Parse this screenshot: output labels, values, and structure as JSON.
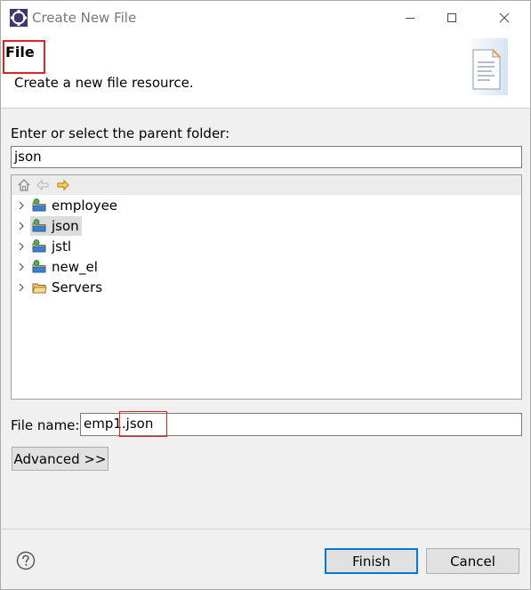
{
  "window": {
    "title": "Create New File"
  },
  "banner": {
    "title": "File",
    "description": "Create a new file resource."
  },
  "parent_folder": {
    "label": "Enter or select the parent folder:",
    "value": "json"
  },
  "tree": {
    "items": [
      {
        "label": "employee",
        "icon": "project-icon",
        "selected": false
      },
      {
        "label": "json",
        "icon": "project-icon",
        "selected": true
      },
      {
        "label": "jstl",
        "icon": "project-icon",
        "selected": false
      },
      {
        "label": "new_el",
        "icon": "project-icon",
        "selected": false
      },
      {
        "label": "Servers",
        "icon": "folder-icon",
        "selected": false
      }
    ]
  },
  "file_name": {
    "label": "File name:",
    "value_part1": "emp1",
    "value_part2": ".json"
  },
  "buttons": {
    "advanced": "Advanced >>",
    "finish": "Finish",
    "cancel": "Cancel"
  },
  "colors": {
    "highlight": "#e02222",
    "default_button_border": "#0078d7"
  }
}
